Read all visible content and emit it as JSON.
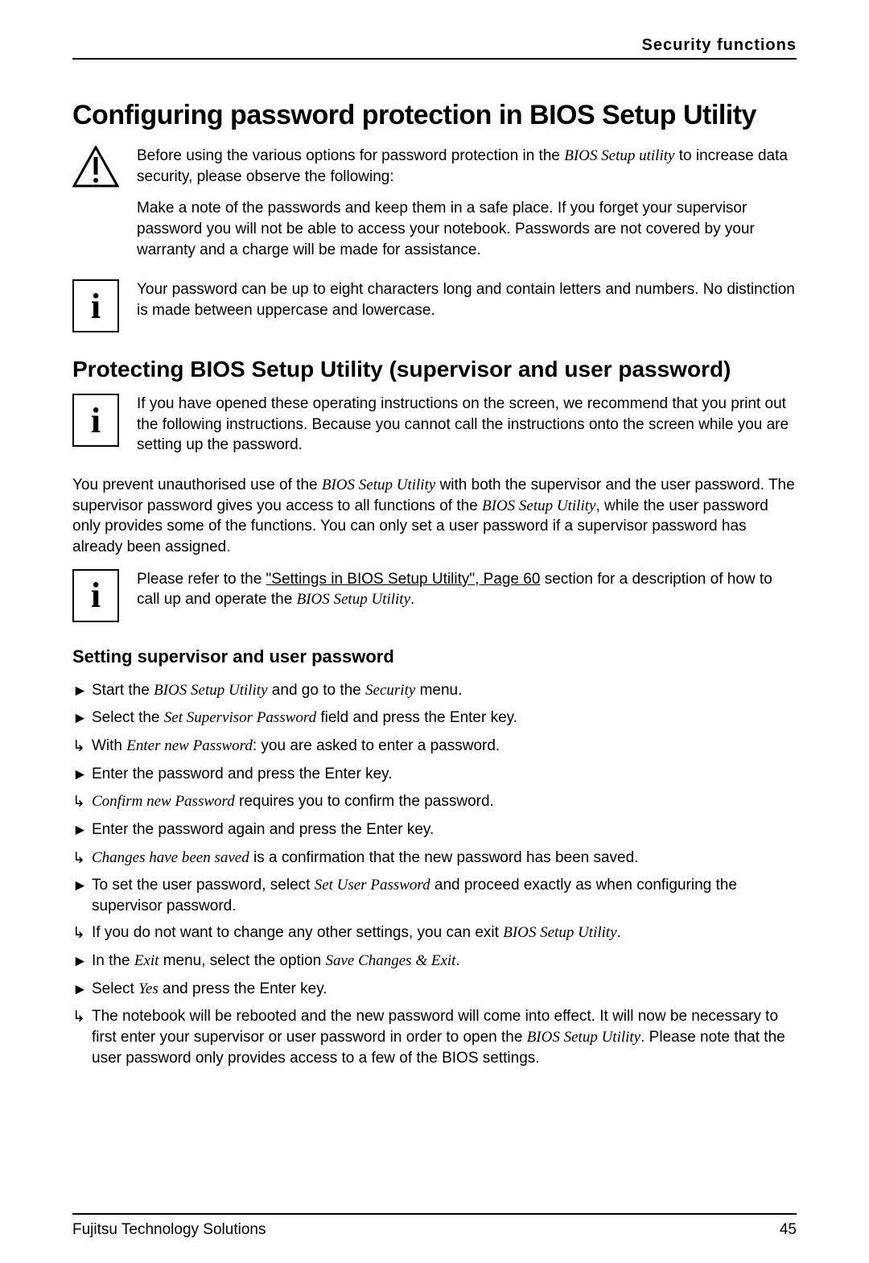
{
  "header": {
    "section": "Security functions"
  },
  "h1": "Configuring password protection in BIOS Setup Utility",
  "warn": {
    "p1a": "Before using the various options for password protection in the ",
    "p1b": "BIOS Setup utility",
    "p1c": " to increase data security, please observe the following:",
    "p2": "Make a note of the passwords and keep them in a safe place. If you forget your supervisor password you will not be able to access your notebook. Passwords are not covered by your warranty and a charge will be made for assistance."
  },
  "info1": {
    "p1": "Your password can be up to eight characters long and contain letters and numbers. No distinction is made between uppercase and lowercase."
  },
  "h2": "Protecting BIOS Setup Utility (supervisor and user password)",
  "info2": {
    "p1": "If you have opened these operating instructions on the screen, we recommend that you print out the following instructions. Because you cannot call the instructions onto the screen while you are setting up the password."
  },
  "para_main_a": "You prevent unauthorised use of the ",
  "para_main_b": "BIOS Setup Utility",
  "para_main_c": " with both the supervisor and the user password. The supervisor password gives you access to all functions of the ",
  "para_main_d": "BIOS Setup Utility",
  "para_main_e": ", while the user password only provides some of the functions. You can only set a user password if a supervisor password has already been assigned.",
  "info3": {
    "p1a": "Please refer to the ",
    "link": "\"Settings in BIOS Setup Utility\", Page 60",
    "p1b": " section for a description of how to call up and operate the ",
    "p1c": "BIOS Setup Utility",
    "p1d": "."
  },
  "h3": "Setting supervisor and user password",
  "steps": [
    {
      "b": "act",
      "t1": "Start the ",
      "i1": "BIOS Setup Utility",
      "t2": " and go to the ",
      "i2": "Security",
      "t3": " menu."
    },
    {
      "b": "act",
      "t1": "Select the ",
      "i1": "Set Supervisor Password",
      "t2": " field and press the Enter key."
    },
    {
      "b": "res",
      "t1": "With ",
      "i1": "Enter new Password",
      "t2": ": you are asked to enter a password."
    },
    {
      "b": "act",
      "t1": "Enter the password and press the Enter key."
    },
    {
      "b": "res",
      "i1": "Confirm new Password",
      "t2": " requires you to confirm the password."
    },
    {
      "b": "act",
      "t1": "Enter the password again and press the Enter key."
    },
    {
      "b": "res",
      "i1": "Changes have been saved",
      "t2": " is a confirmation that the new password has been saved."
    },
    {
      "b": "act",
      "t1": "To set the user password, select ",
      "i1": "Set User Password",
      "t2": " and proceed exactly as when configuring the supervisor password."
    },
    {
      "b": "res",
      "t1": "If you do not want to change any other settings, you can exit ",
      "i1": "BIOS Setup Utility",
      "t2": "."
    },
    {
      "b": "act",
      "t1": "In the ",
      "i1": "Exit",
      "t2": " menu, select the option ",
      "i2": "Save Changes & Exit",
      "t3": "."
    },
    {
      "b": "act",
      "t1": "Select ",
      "i1": "Yes",
      "t2": " and press the Enter key."
    },
    {
      "b": "res",
      "t1": "The notebook will be rebooted and the new password will come into effect. It will now be necessary to first enter your supervisor or user password in order to open the ",
      "i1": "BIOS Setup Utility",
      "t2": ". Please note that the user password only provides access to a few of the BIOS settings."
    }
  ],
  "footer": {
    "left": "Fujitsu Technology Solutions",
    "right": "45"
  }
}
